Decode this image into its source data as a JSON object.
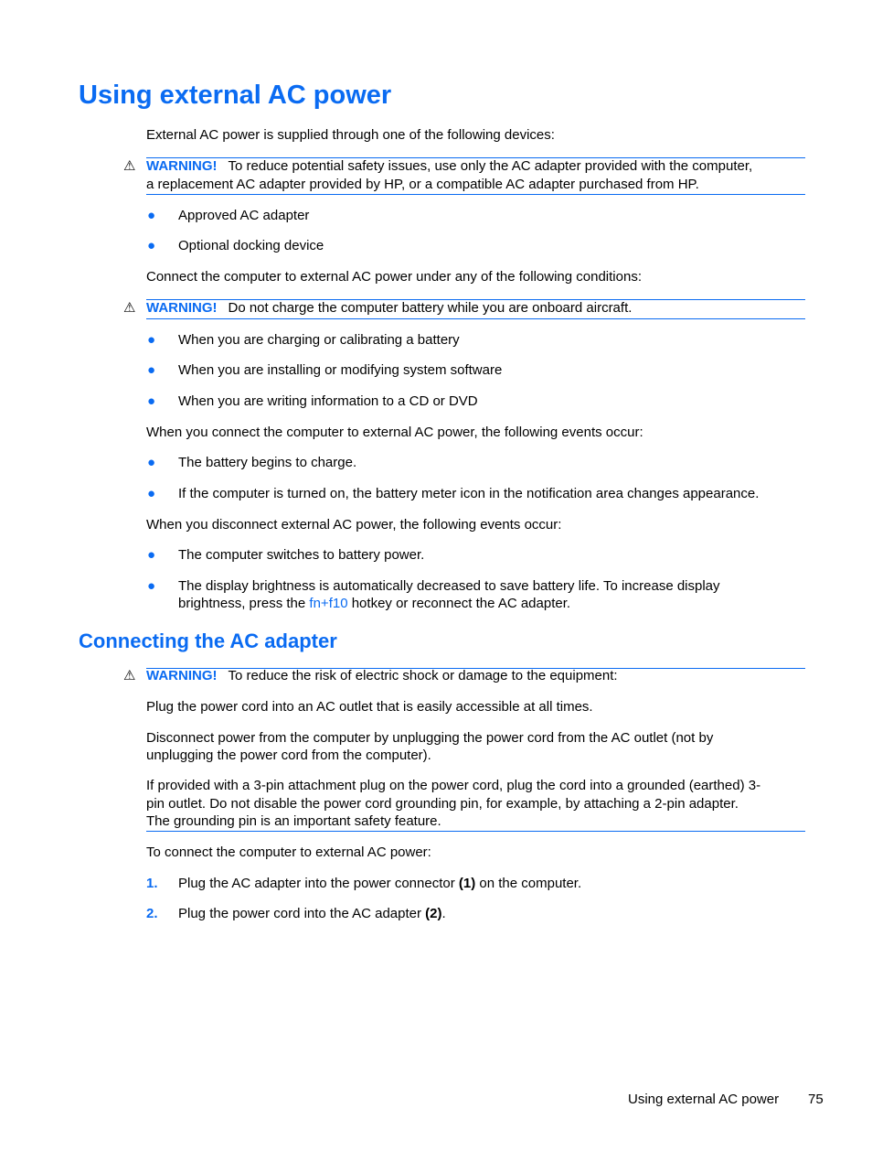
{
  "page": {
    "title": "Using external AC power",
    "intro": "External AC power is supplied through one of the following devices:",
    "warning_label": "WARNING!",
    "warning_icon": "warning-triangle-icon",
    "warning1": {
      "line1": "To reduce potential safety issues, use only the AC adapter provided with the computer,",
      "line2": "a replacement AC adapter provided by HP, or a compatible AC adapter purchased from HP."
    },
    "devices": [
      "Approved AC adapter",
      "Optional docking device"
    ],
    "conditions_intro": "Connect the computer to external AC power under any of the following conditions:",
    "warning2": "Do not charge the computer battery while you are onboard aircraft.",
    "conditions": [
      "When you are charging or calibrating a battery",
      "When you are installing or modifying system software",
      "When you are writing information to a CD or DVD"
    ],
    "connect_intro": "When you connect the computer to external AC power, the following events occur:",
    "connect_events": [
      "The battery begins to charge.",
      "If the computer is turned on, the battery meter icon in the notification area changes appearance."
    ],
    "disconnect_intro": "When you disconnect external AC power, the following events occur:",
    "disconnect_events": {
      "item1": "The computer switches to battery power.",
      "item2_line1": "The display brightness is automatically decreased to save battery life. To increase display",
      "item2_line2_pre": "brightness, press the ",
      "item2_hotkey": "fn+f10",
      "item2_line2_post": " hotkey or reconnect the AC adapter."
    }
  },
  "section2": {
    "title": "Connecting the AC adapter",
    "warning3": "To reduce the risk of electric shock or damage to the equipment:",
    "p1": "Plug the power cord into an AC outlet that is easily accessible at all times.",
    "p2_line1": "Disconnect power from the computer by unplugging the power cord from the AC outlet (not by",
    "p2_line2": "unplugging the power cord from the computer).",
    "p3_line1": "If provided with a 3-pin attachment plug on the power cord, plug the cord into a grounded (earthed) 3-",
    "p3_line2": "pin outlet. Do not disable the power cord grounding pin, for example, by attaching a 2-pin adapter.",
    "p3_line3": "The grounding pin is an important safety feature.",
    "steps_intro": "To connect the computer to external AC power:",
    "steps": [
      {
        "num": "1.",
        "pre": "Plug the AC adapter into the power connector ",
        "bold": "(1)",
        "post": " on the computer."
      },
      {
        "num": "2.",
        "pre": "Plug the power cord into the AC adapter ",
        "bold": "(2)",
        "post": "."
      }
    ]
  },
  "footer": {
    "section": "Using external AC power",
    "page_number": "75"
  },
  "colors": {
    "accent": "#0a6bf2",
    "text": "#000000"
  }
}
